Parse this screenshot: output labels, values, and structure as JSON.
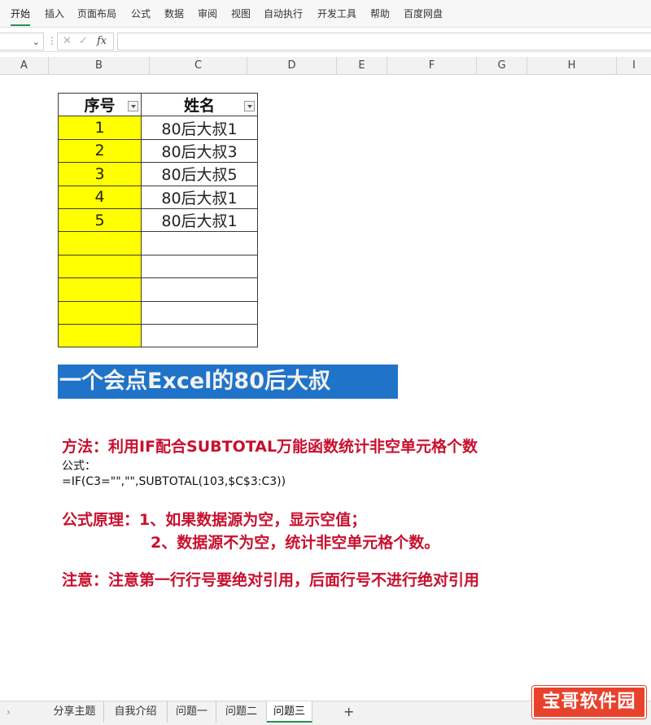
{
  "menu": [
    "开始",
    "插入",
    "页面布局",
    "公式",
    "数据",
    "审阅",
    "视图",
    "自动执行",
    "开发工具",
    "帮助",
    "百度网盘"
  ],
  "formula_bar": {
    "fx_label": "fx",
    "value": ""
  },
  "columns": [
    "A",
    "B",
    "C",
    "D",
    "E",
    "F",
    "G",
    "H",
    "I"
  ],
  "table": {
    "headers": [
      "序号",
      "姓名"
    ],
    "rows": [
      [
        "1",
        "80后大叔1"
      ],
      [
        "2",
        "80后大叔3"
      ],
      [
        "3",
        "80后大叔5"
      ],
      [
        "4",
        "80后大叔1"
      ],
      [
        "5",
        "80后大叔1"
      ],
      [
        "",
        ""
      ],
      [
        "",
        ""
      ],
      [
        "",
        ""
      ],
      [
        "",
        ""
      ],
      [
        "",
        ""
      ]
    ]
  },
  "banner": {
    "text": "一个会点Excel的80后大叔"
  },
  "notes": {
    "method": "方法：利用IF配合SUBTOTAL万能函数统计非空单元格个数",
    "formula_label": "公式：",
    "formula": "=IF(C3=\"\",\"\",SUBTOTAL(103,$C$3:C3))",
    "principle_1": "公式原理：1、如果数据源为空，显示空值；",
    "principle_2": "2、数据源不为空，统计非空单元格个数。",
    "note": "注意：注意第一行行号要绝对引用，后面行号不进行绝对引用"
  },
  "sheet_tabs": [
    "分享主题",
    "自我介绍",
    "问题一",
    "问题二",
    "问题三"
  ],
  "active_tab": "问题三",
  "add_tab": "+",
  "watermark": "宝哥软件园",
  "colors": {
    "highlight": "#ffff00",
    "banner": "#1f73c8",
    "note_red": "#c8102e",
    "accent": "#2a8f4f"
  }
}
